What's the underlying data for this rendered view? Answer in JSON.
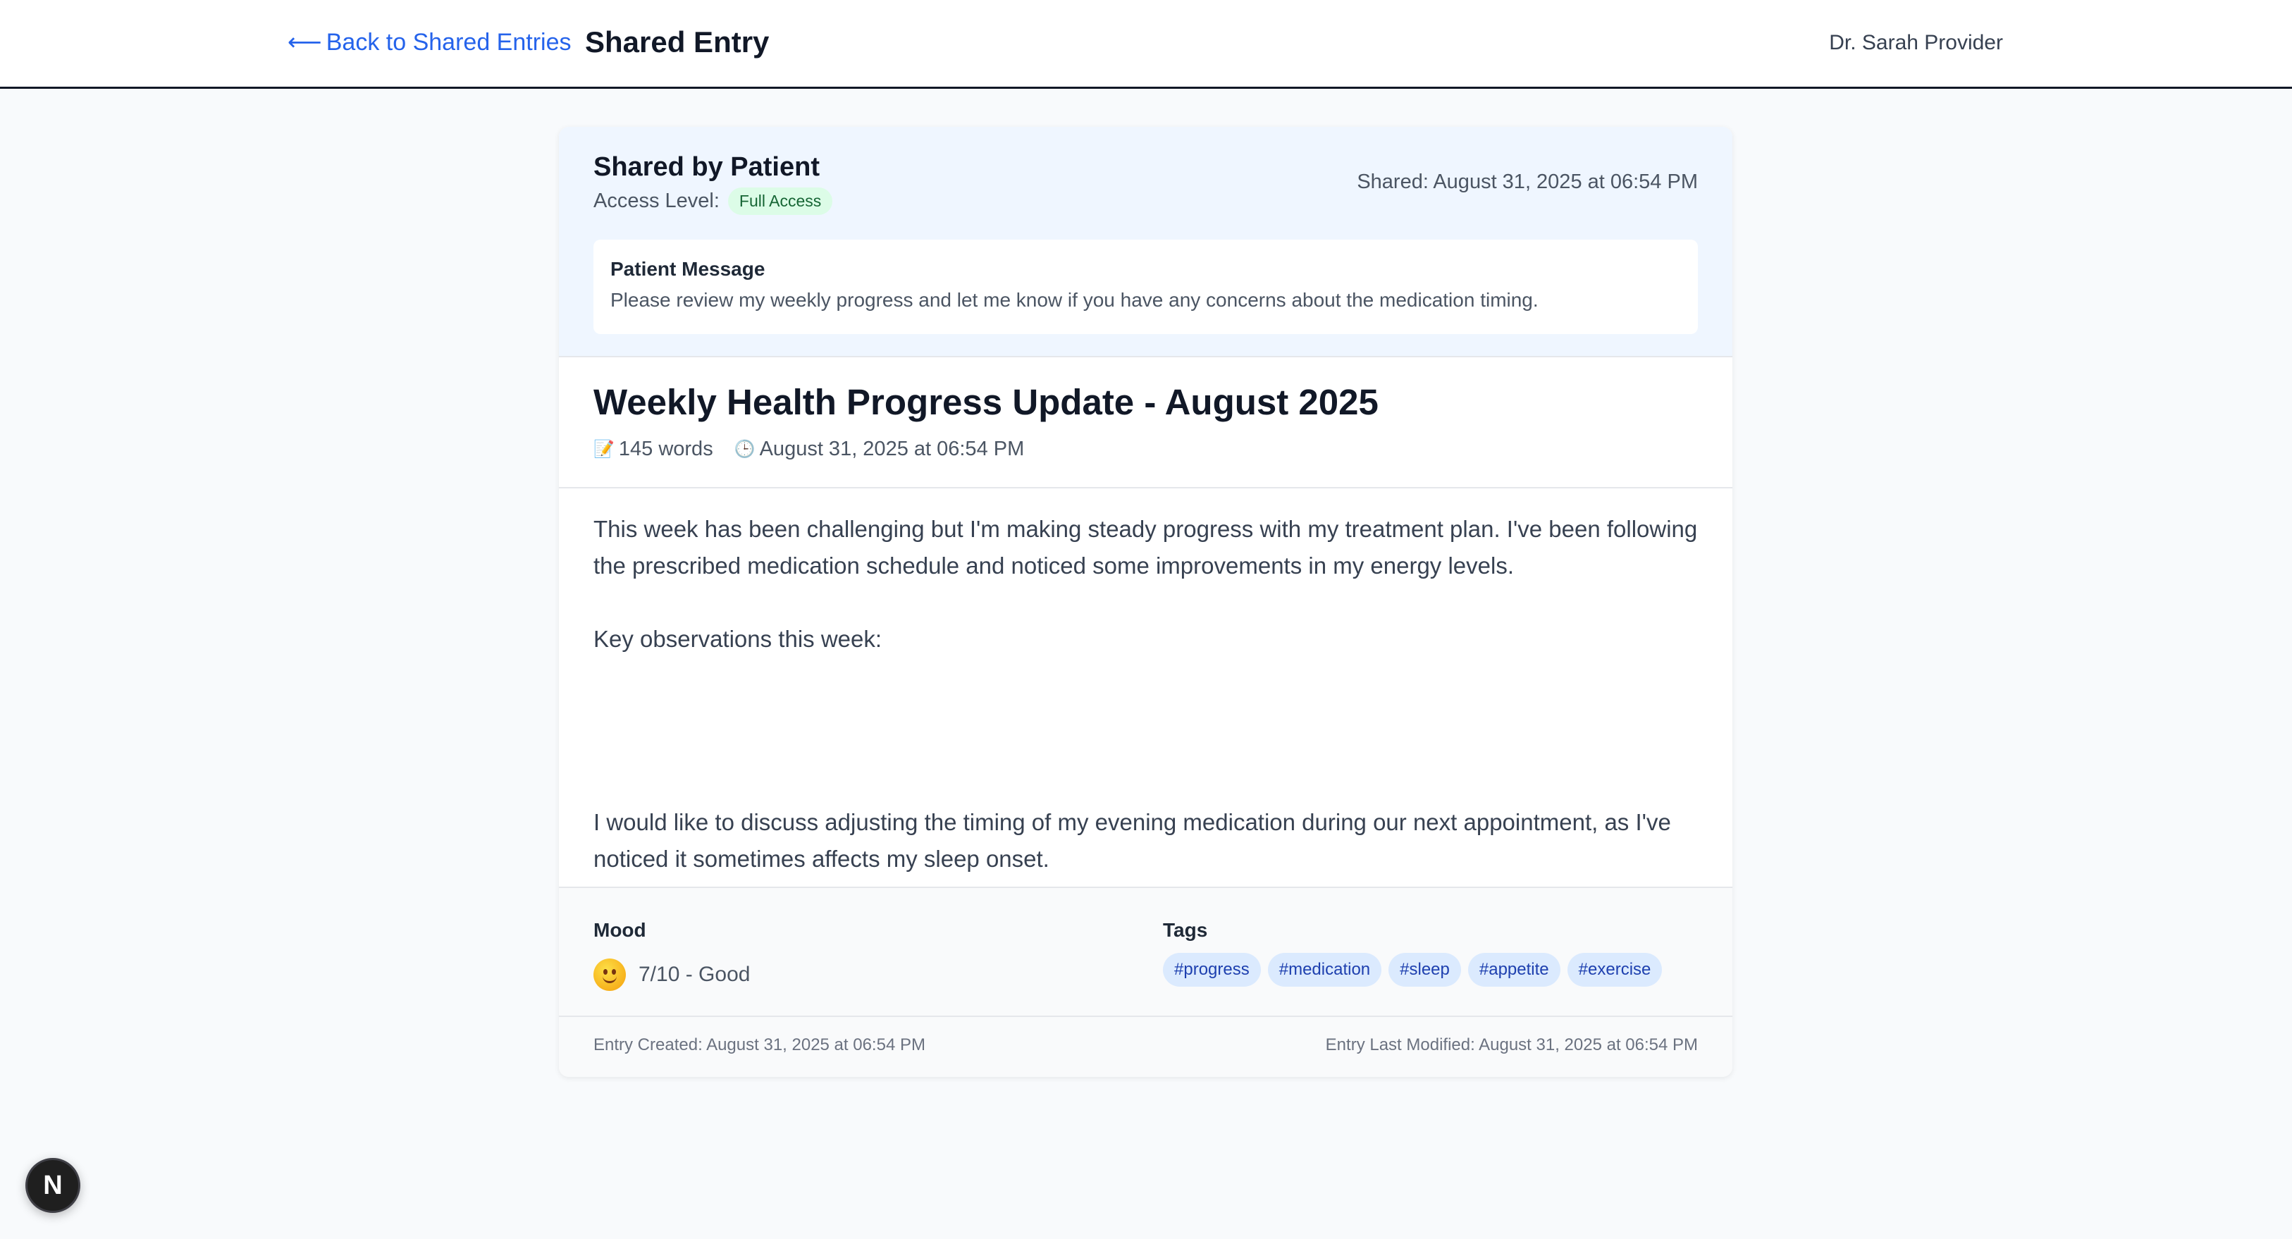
{
  "header": {
    "back_arrow": "⟵",
    "back_label": "Back to Shared Entries",
    "title": "Shared Entry",
    "user_name": "Dr. Sarah Provider"
  },
  "share_info": {
    "heading": "Shared by Patient",
    "access_label": "Access Level:",
    "access_value": "Full Access",
    "shared_date": "Shared: August 31, 2025 at 06:54 PM",
    "message_label": "Patient Message",
    "message_text": "Please review my weekly progress and let me know if you have any concerns about the medication timing."
  },
  "entry": {
    "title": "Weekly Health Progress Update - August 2025",
    "word_count_icon": "memo-icon",
    "word_count": "145 words",
    "date_icon": "clock-icon",
    "date": "August 31, 2025 at 06:54 PM",
    "paragraphs": [
      "This week has been challenging but I'm making steady progress with my treatment plan. I've been following the prescribed medication schedule and noticed some improvements in my energy levels.",
      "Key observations this week:",
      "I would like to discuss adjusting the timing of my evening medication during our next appointment, as I've noticed it sometimes affects my sleep onset."
    ]
  },
  "mood": {
    "label": "Mood",
    "icon": "slightly-smiling-face-icon",
    "value": "7/10 - Good"
  },
  "tags": {
    "label": "Tags",
    "items": [
      "#progress",
      "#medication",
      "#sleep",
      "#appetite",
      "#exercise"
    ]
  },
  "footer": {
    "created": "Entry Created: August 31, 2025 at 06:54 PM",
    "modified": "Entry Last Modified: August 31, 2025 at 06:54 PM"
  },
  "dev_indicator": {
    "letter": "N"
  },
  "colors": {
    "accent": "#2563eb",
    "banner_bg": "#eff6ff",
    "badge_bg": "#dcfce7",
    "badge_text": "#166534",
    "tag_bg": "#dbeafe",
    "tag_text": "#1e40af"
  }
}
